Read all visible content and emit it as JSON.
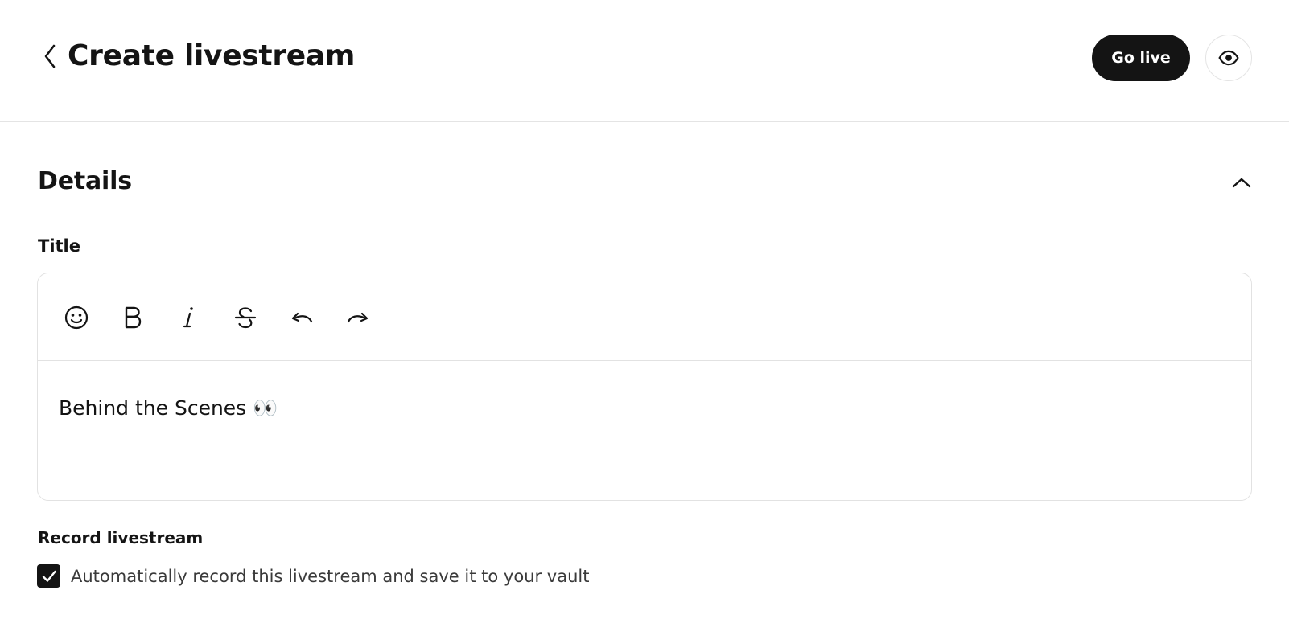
{
  "header": {
    "title": "Create livestream",
    "back_icon": "chevron-left-icon",
    "go_live_label": "Go live",
    "preview_icon": "eye-icon"
  },
  "details": {
    "section_title": "Details",
    "collapse_icon": "chevron-up-icon",
    "title_field": {
      "label": "Title",
      "value": "Behind the Scenes 👀",
      "toolbar": [
        {
          "name": "emoji",
          "icon": "smiley-icon"
        },
        {
          "name": "bold",
          "icon": "bold-icon"
        },
        {
          "name": "italic",
          "icon": "italic-icon"
        },
        {
          "name": "strikethrough",
          "icon": "strikethrough-icon"
        },
        {
          "name": "undo",
          "icon": "undo-icon"
        },
        {
          "name": "redo",
          "icon": "redo-icon"
        }
      ]
    },
    "record": {
      "label": "Record livestream",
      "checkbox_label": "Automatically record this livestream and save it to your vault",
      "checked": true
    }
  },
  "colors": {
    "primary": "#141414",
    "border": "#e2e2e2",
    "background": "#ffffff"
  }
}
